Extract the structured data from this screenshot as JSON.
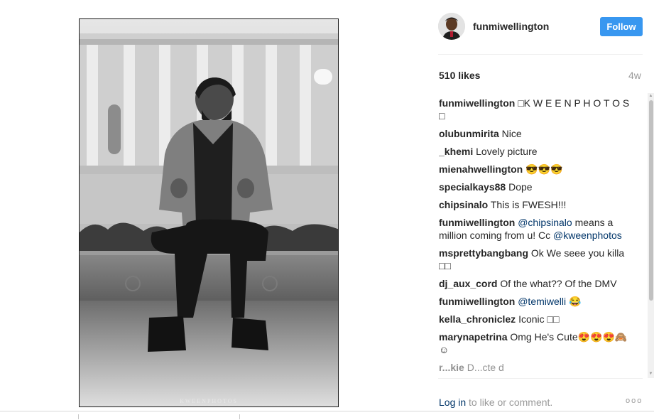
{
  "post": {
    "image_watermark": "KWEENPHOTOS",
    "author": "funmiwellington",
    "follow_label": "Follow",
    "likes": "510 likes",
    "age": "4w"
  },
  "comments": [
    {
      "user": "funmiwellington",
      "text": "□K W E E N P H O T O S □"
    },
    {
      "user": "olubunmirita",
      "text": "Nice"
    },
    {
      "user": "_khemi",
      "text": "Lovely picture"
    },
    {
      "user": "mienahwellington",
      "text": "😎😎😎"
    },
    {
      "user": "specialkays88",
      "text": "Dope"
    },
    {
      "user": "chipsinalo",
      "text": "This is FWESH!!!"
    },
    {
      "user": "funmiwellington",
      "mention1": "@chipsinalo",
      "text": "means a million coming from u! Cc",
      "mention2": "@kweenphotos"
    },
    {
      "user": "msprettybangbang",
      "text": "Ok We seee you killa □□"
    },
    {
      "user": "dj_aux_cord",
      "text": "Of the what?? Of the DMV"
    },
    {
      "user": "funmiwellington",
      "mention1": "@temiwelli",
      "text": "😂"
    },
    {
      "user": "kella_chroniclez",
      "text": "Iconic □□"
    },
    {
      "user": "marynapetrina",
      "text": "Omg He's Cute😍😍😍🙈☺"
    },
    {
      "user": "r...kie",
      "text": "D...cte d"
    }
  ],
  "footer": {
    "login_link": "Log in",
    "login_rest": " to like or comment.",
    "more": "ooo"
  },
  "colors": {
    "accent": "#3897f0",
    "link": "#003569"
  }
}
